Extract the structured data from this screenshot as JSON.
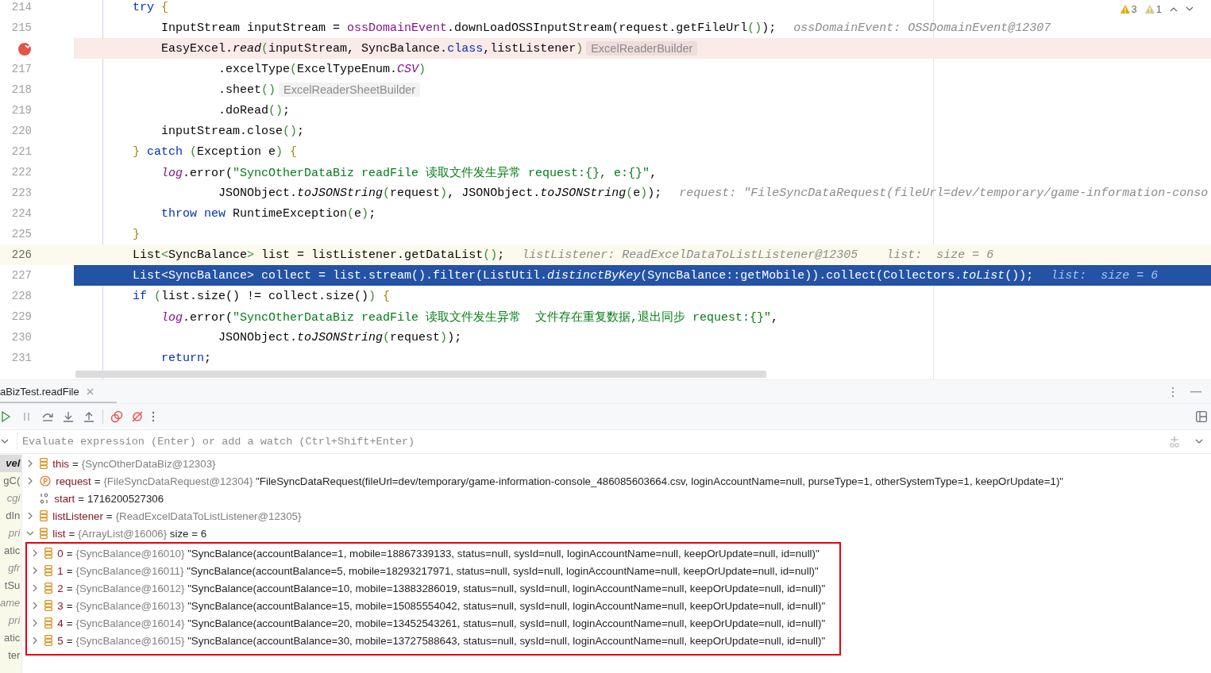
{
  "editor": {
    "inspections": [
      {
        "count": "3",
        "kind": "warning"
      },
      {
        "count": "1",
        "kind": "weak"
      }
    ],
    "lines": [
      {
        "number": "214",
        "breakpoint": false,
        "caret": false,
        "execution": false,
        "tokens": [
          {
            "text": "        try",
            "kind": "kw"
          },
          {
            "text": " {",
            "kind": "brace"
          }
        ]
      },
      {
        "number": "215",
        "breakpoint": false,
        "caret": false,
        "execution": false,
        "tokens": [
          {
            "text": "            InputStream inputStream = ",
            "kind": "plain"
          },
          {
            "text": "ossDomainEvent",
            "kind": "field"
          },
          {
            "text": ".downLoadOSSInputStream(request.getFileUrl",
            "kind": "plain"
          },
          {
            "text": "()",
            "kind": "paren"
          },
          {
            "text": ");",
            "kind": "plain"
          }
        ],
        "hint": "ossDomainEvent: OSSDomainEvent@12307"
      },
      {
        "breakpoint": true,
        "caret": false,
        "execution": false,
        "tokens": [
          {
            "text": "            EasyExcel.",
            "kind": "plain"
          },
          {
            "text": "read",
            "kind": "italic"
          },
          {
            "text": "(",
            "kind": "paren"
          },
          {
            "text": "inputStream, SyncBalance.",
            "kind": "plain"
          },
          {
            "text": "class",
            "kind": "kw"
          },
          {
            "text": ",listListener",
            "kind": "plain"
          },
          {
            "text": ")",
            "kind": "paren"
          }
        ],
        "inlay": "ExcelReaderBuilder"
      },
      {
        "number": "217",
        "breakpoint": false,
        "caret": false,
        "execution": false,
        "tokens": [
          {
            "text": "                    .excelType",
            "kind": "plain"
          },
          {
            "text": "(",
            "kind": "paren"
          },
          {
            "text": "ExcelTypeEnum.",
            "kind": "plain"
          },
          {
            "text": "CSV",
            "kind": "static"
          },
          {
            "text": ")",
            "kind": "paren"
          }
        ]
      },
      {
        "number": "218",
        "breakpoint": false,
        "caret": false,
        "execution": false,
        "tokens": [
          {
            "text": "                    .sheet",
            "kind": "plain"
          },
          {
            "text": "()",
            "kind": "paren"
          }
        ],
        "inlay": "ExcelReaderSheetBuilder"
      },
      {
        "number": "219",
        "breakpoint": false,
        "caret": false,
        "execution": false,
        "tokens": [
          {
            "text": "                    .doRead",
            "kind": "plain"
          },
          {
            "text": "()",
            "kind": "paren"
          },
          {
            "text": ";",
            "kind": "plain"
          }
        ]
      },
      {
        "number": "220",
        "breakpoint": false,
        "caret": false,
        "execution": false,
        "tokens": [
          {
            "text": "            inputStream.close",
            "kind": "plain"
          },
          {
            "text": "()",
            "kind": "paren"
          },
          {
            "text": ";",
            "kind": "plain"
          }
        ]
      },
      {
        "number": "221",
        "breakpoint": false,
        "caret": false,
        "execution": false,
        "tokens": [
          {
            "text": "        }",
            "kind": "brace"
          },
          {
            "text": " catch",
            "kind": "kw"
          },
          {
            "text": " (",
            "kind": "paren"
          },
          {
            "text": "Exception e",
            "kind": "plain"
          },
          {
            "text": ")",
            "kind": "paren"
          },
          {
            "text": " {",
            "kind": "brace"
          }
        ]
      },
      {
        "number": "222",
        "breakpoint": false,
        "caret": false,
        "execution": false,
        "tokens": [
          {
            "text": "            log",
            "kind": "static"
          },
          {
            "text": ".error(",
            "kind": "plain"
          },
          {
            "text": "\"SyncOtherDataBiz readFile 读取文件发生异常 request:{}, e:{}\"",
            "kind": "str"
          },
          {
            "text": ",",
            "kind": "plain"
          }
        ]
      },
      {
        "number": "223",
        "breakpoint": false,
        "caret": false,
        "execution": false,
        "tokens": [
          {
            "text": "                    JSONObject.",
            "kind": "plain"
          },
          {
            "text": "toJSONString",
            "kind": "italic"
          },
          {
            "text": "(",
            "kind": "paren"
          },
          {
            "text": "request",
            "kind": "plain"
          },
          {
            "text": ")",
            "kind": "paren"
          },
          {
            "text": ", JSONObject.",
            "kind": "plain"
          },
          {
            "text": "toJSONString",
            "kind": "italic"
          },
          {
            "text": "(",
            "kind": "paren"
          },
          {
            "text": "e",
            "kind": "plain"
          },
          {
            "text": ")",
            "kind": "paren"
          },
          {
            "text": ");",
            "kind": "plain"
          }
        ],
        "hint": "request: \"FileSyncDataRequest(fileUrl=dev/temporary/game-information-conso"
      },
      {
        "number": "224",
        "breakpoint": false,
        "caret": false,
        "execution": false,
        "tokens": [
          {
            "text": "            throw",
            "kind": "kw"
          },
          {
            "text": " new",
            "kind": "kw"
          },
          {
            "text": " RuntimeException",
            "kind": "plain"
          },
          {
            "text": "(",
            "kind": "paren"
          },
          {
            "text": "e",
            "kind": "plain"
          },
          {
            "text": ")",
            "kind": "paren"
          },
          {
            "text": ";",
            "kind": "plain"
          }
        ]
      },
      {
        "number": "225",
        "breakpoint": false,
        "caret": false,
        "execution": false,
        "tokens": [
          {
            "text": "        }",
            "kind": "brace"
          }
        ]
      },
      {
        "number": "226",
        "breakpoint": false,
        "caret": true,
        "execution": false,
        "tokens": [
          {
            "text": "        List",
            "kind": "plain"
          },
          {
            "text": "<",
            "kind": "paren"
          },
          {
            "text": "SyncBalance",
            "kind": "plain"
          },
          {
            "text": ">",
            "kind": "paren"
          },
          {
            "text": " list = listListener.getDataList",
            "kind": "plain"
          },
          {
            "text": "()",
            "kind": "paren"
          },
          {
            "text": ";",
            "kind": "plain"
          }
        ],
        "hint": "listListener: ReadExcelDataToListListener@12305    list:  size = 6"
      },
      {
        "number": "227",
        "breakpoint": false,
        "caret": false,
        "execution": true,
        "tokens": [
          {
            "text": "        List<SyncBalance> collect = list.stream().filter(ListUtil.",
            "kind": "plain"
          },
          {
            "text": "distinctByKey",
            "kind": "italic"
          },
          {
            "text": "(SyncBalance::getMobile)).collect(Collectors.",
            "kind": "plain"
          },
          {
            "text": "toList",
            "kind": "italic"
          },
          {
            "text": "());",
            "kind": "plain"
          }
        ],
        "hint": "list:  size = 6"
      },
      {
        "number": "228",
        "breakpoint": false,
        "caret": false,
        "execution": false,
        "tokens": [
          {
            "text": "        if",
            "kind": "kw"
          },
          {
            "text": " (",
            "kind": "paren"
          },
          {
            "text": "list.size() != collect.size()",
            "kind": "plain"
          },
          {
            "text": ")",
            "kind": "paren"
          },
          {
            "text": " {",
            "kind": "brace"
          }
        ]
      },
      {
        "number": "229",
        "breakpoint": false,
        "caret": false,
        "execution": false,
        "tokens": [
          {
            "text": "            log",
            "kind": "static"
          },
          {
            "text": ".error(",
            "kind": "plain"
          },
          {
            "text": "\"SyncOtherDataBiz readFile 读取文件发生异常  文件存在重复数据,退出同步 request:{}\"",
            "kind": "str"
          },
          {
            "text": ",",
            "kind": "plain"
          }
        ]
      },
      {
        "number": "230",
        "breakpoint": false,
        "caret": false,
        "execution": false,
        "tokens": [
          {
            "text": "                    JSONObject.",
            "kind": "plain"
          },
          {
            "text": "toJSONString",
            "kind": "italic"
          },
          {
            "text": "(",
            "kind": "paren"
          },
          {
            "text": "request",
            "kind": "plain"
          },
          {
            "text": ")",
            "kind": "paren"
          },
          {
            "text": ");",
            "kind": "plain"
          }
        ]
      },
      {
        "number": "231",
        "breakpoint": false,
        "caret": false,
        "execution": false,
        "tokens": [
          {
            "text": "            return",
            "kind": "kw"
          },
          {
            "text": ";",
            "kind": "plain"
          }
        ]
      }
    ]
  },
  "debug_panel": {
    "tab": {
      "label": "aBizTest.readFile",
      "selected": true
    },
    "evaluate": {
      "placeholder": "Evaluate expression (Enter) or add a watch (Ctrl+Shift+Enter)"
    },
    "frames": [
      {
        "text": "vel",
        "kind": "project",
        "selected": true
      },
      {
        "text": "gC(",
        "kind": "project",
        "selected": false
      },
      {
        "text": "cgi",
        "kind": "library",
        "selected": false
      },
      {
        "text": "dIn",
        "kind": "project",
        "selected": false
      },
      {
        "text": "pri",
        "kind": "library",
        "selected": false
      },
      {
        "text": "atic",
        "kind": "project",
        "selected": false
      },
      {
        "text": "gfr",
        "kind": "library",
        "selected": false
      },
      {
        "text": "tSu",
        "kind": "project",
        "selected": false
      },
      {
        "text": "ame",
        "kind": "library",
        "selected": false
      },
      {
        "text": "pri",
        "kind": "library",
        "selected": false
      },
      {
        "text": "atic",
        "kind": "project",
        "selected": false
      },
      {
        "text": "ter",
        "kind": "project",
        "selected": false
      }
    ],
    "variables": [
      {
        "kind": "object",
        "name": "this",
        "operator": "=",
        "type": "{SyncOtherDataBiz@12303}",
        "expandable": true,
        "expanded": false
      },
      {
        "kind": "param",
        "name": "request",
        "operator": "=",
        "type": "{FileSyncDataRequest@12304}",
        "value": "\"FileSyncDataRequest(fileUrl=dev/temporary/game-information-console_486085603664.csv, loginAccountName=null, purseType=1, otherSystemType=1, keepOrUpdate=1)\"",
        "expandable": true,
        "expanded": false
      },
      {
        "kind": "primitive",
        "name": "start",
        "operator": "=",
        "value": "1716200527306",
        "expandable": false
      },
      {
        "kind": "object",
        "name": "listListener",
        "operator": "=",
        "type": "{ReadExcelDataToListListener@12305}",
        "expandable": true,
        "expanded": false
      },
      {
        "kind": "object",
        "name": "list",
        "operator": "=",
        "type": "{ArrayList@16006}",
        "value": "size = 6",
        "expandable": true,
        "expanded": true,
        "outlined": true,
        "children": [
          {
            "kind": "object",
            "name": "0",
            "operator": "=",
            "type": "{SyncBalance@16010}",
            "value": "\"SyncBalance(accountBalance=1, mobile=18867339133, status=null, sysId=null, loginAccountName=null, keepOrUpdate=null, id=null)\"",
            "expandable": true,
            "expanded": false
          },
          {
            "kind": "object",
            "name": "1",
            "operator": "=",
            "type": "{SyncBalance@16011}",
            "value": "\"SyncBalance(accountBalance=5, mobile=18293217971, status=null, sysId=null, loginAccountName=null, keepOrUpdate=null, id=null)\"",
            "expandable": true,
            "expanded": false
          },
          {
            "kind": "object",
            "name": "2",
            "operator": "=",
            "type": "{SyncBalance@16012}",
            "value": "\"SyncBalance(accountBalance=10, mobile=13883286019, status=null, sysId=null, loginAccountName=null, keepOrUpdate=null, id=null)\"",
            "expandable": true,
            "expanded": false
          },
          {
            "kind": "object",
            "name": "3",
            "operator": "=",
            "type": "{SyncBalance@16013}",
            "value": "\"SyncBalance(accountBalance=15, mobile=15085554042, status=null, sysId=null, loginAccountName=null, keepOrUpdate=null, id=null)\"",
            "expandable": true,
            "expanded": false
          },
          {
            "kind": "object",
            "name": "4",
            "operator": "=",
            "type": "{SyncBalance@16014}",
            "value": "\"SyncBalance(accountBalance=20, mobile=13452543261, status=null, sysId=null, loginAccountName=null, keepOrUpdate=null, id=null)\"",
            "expandable": true,
            "expanded": false
          },
          {
            "kind": "object",
            "name": "5",
            "operator": "=",
            "type": "{SyncBalance@16015}",
            "value": "\"SyncBalance(accountBalance=30, mobile=13727588643, status=null, sysId=null, loginAccountName=null, keepOrUpdate=null, id=null)\"",
            "expandable": true,
            "expanded": false
          }
        ]
      }
    ]
  }
}
